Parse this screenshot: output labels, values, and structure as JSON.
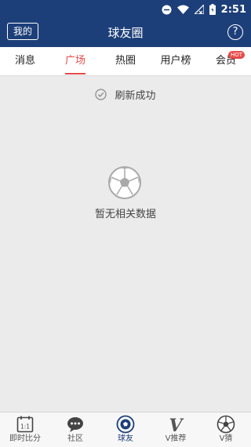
{
  "status_bar": {
    "time": "2:51"
  },
  "app_bar": {
    "mine_button": "我的",
    "title": "球友圈",
    "help_label": "?"
  },
  "tabs": [
    {
      "label": "消息",
      "active": false
    },
    {
      "label": "广场",
      "active": true
    },
    {
      "label": "热圈",
      "active": false
    },
    {
      "label": "用户榜",
      "active": false
    },
    {
      "label": "会员",
      "active": false,
      "badge": "HOT"
    }
  ],
  "content": {
    "refresh_message": "刷新成功",
    "empty_message": "暂无相关数据"
  },
  "bottom_nav": [
    {
      "label": "即时比分",
      "icon": "calendar-score-icon",
      "active": false
    },
    {
      "label": "社区",
      "icon": "chat-bubble-icon",
      "active": false
    },
    {
      "label": "球友",
      "icon": "football-icon",
      "active": true
    },
    {
      "label": "V推荐",
      "icon": "v-letter-icon",
      "active": false
    },
    {
      "label": "V猜",
      "icon": "soccer-ball-icon",
      "active": false
    }
  ],
  "colors": {
    "primary": "#1d3f79",
    "accent": "#e64a4a",
    "background": "#ebebeb"
  }
}
